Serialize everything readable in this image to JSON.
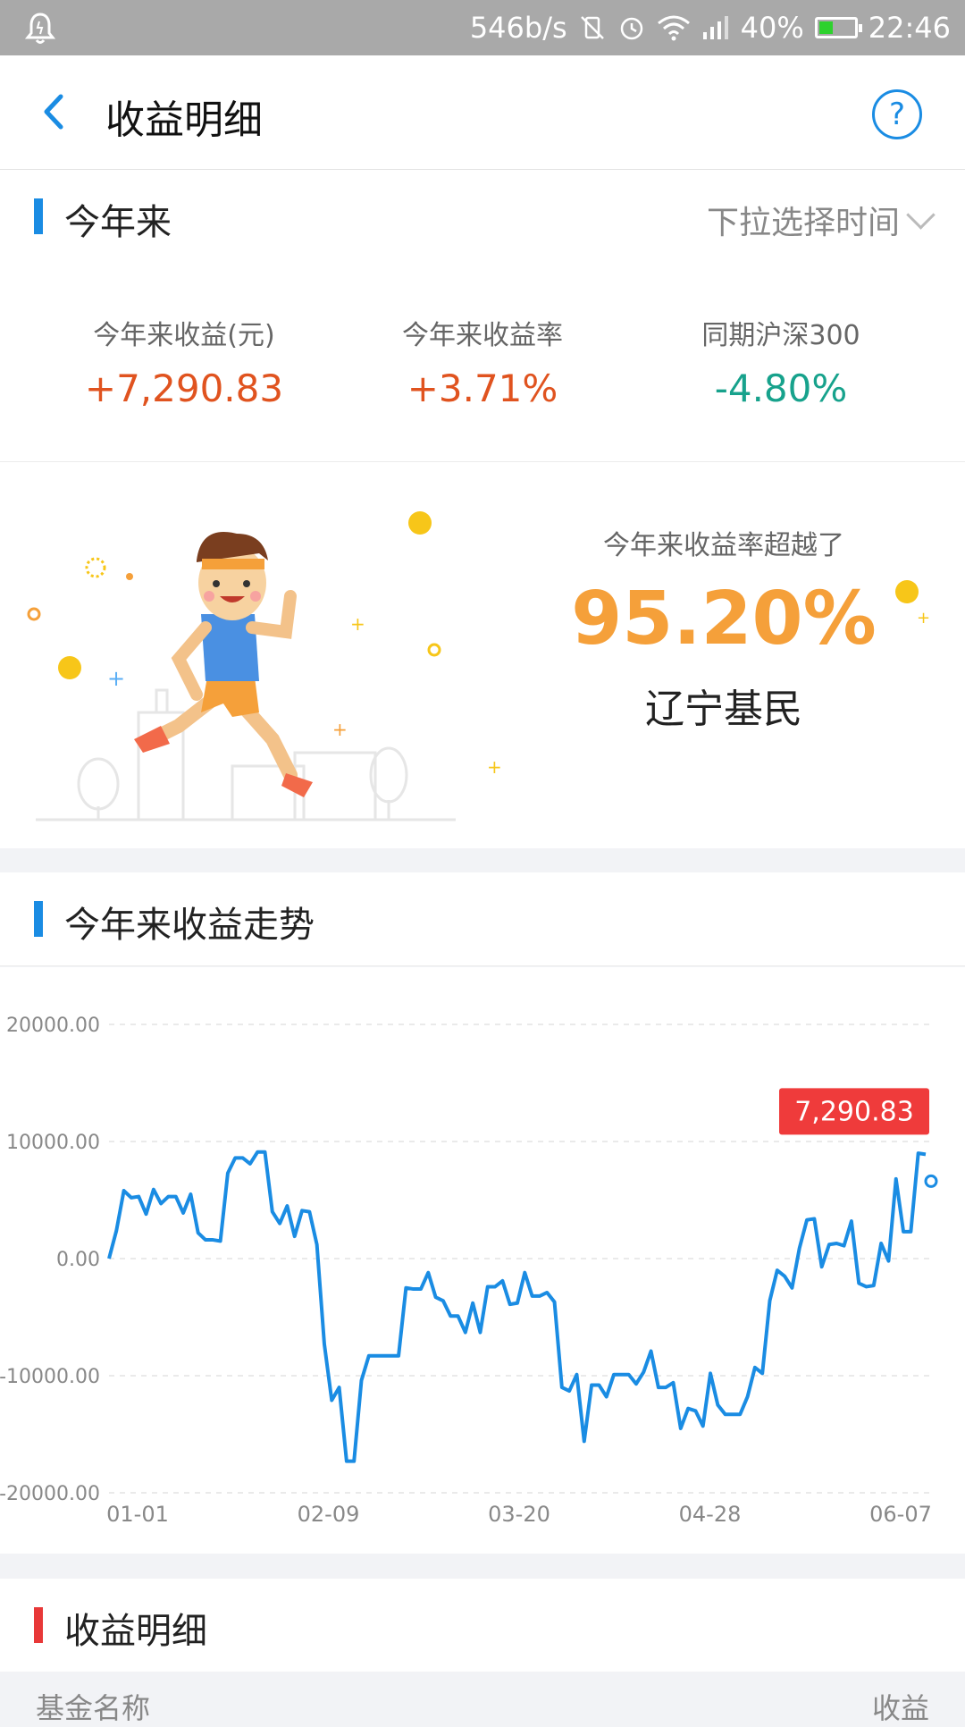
{
  "status_bar": {
    "net_speed": "546b/s",
    "battery": "40%",
    "battery_fraction": 0.4,
    "time": "22:46"
  },
  "header": {
    "title": "收益明细",
    "help_icon": "?"
  },
  "period_section": {
    "title": "今年来",
    "selector_placeholder": "下拉选择时间"
  },
  "stats": [
    {
      "label": "今年来收益(元)",
      "value": "+7,290.83",
      "color": "#e0531f"
    },
    {
      "label": "今年来收益率",
      "value": "+3.71%",
      "color": "#e0531f"
    },
    {
      "label": "同期沪深300",
      "value": "-4.80%",
      "color": "#17a28c"
    }
  ],
  "promo": {
    "label": "今年来收益率超越了",
    "percent": "95.20%",
    "group": "辽宁基民"
  },
  "trend_section": {
    "title": "今年来收益走势"
  },
  "chart_data": {
    "type": "line",
    "y_ticks": [
      "20000.00",
      "10000.00",
      "0.00",
      "-10000.00",
      "-20000.00"
    ],
    "ylim": [
      -20000,
      20000
    ],
    "x_ticks": [
      "01-01",
      "02-09",
      "03-20",
      "04-28",
      "06-07"
    ],
    "latest_label": "7,290.83",
    "line_color": "#1a8ce3",
    "series": [
      {
        "values": [
          0,
          2400,
          5800,
          5200,
          5300,
          3800,
          5900,
          4700,
          5300,
          5300,
          3900,
          5500,
          2200,
          1600,
          1600,
          1500,
          7300,
          8600,
          8600,
          8100,
          9100,
          9100,
          4000,
          3000,
          4500,
          1900,
          4100,
          4000,
          1200,
          -7300,
          -12100,
          -11000,
          -17300,
          -17300,
          -10400,
          -8300,
          -8300,
          -8300,
          -8300,
          -8300,
          -2500,
          -2600,
          -2600,
          -1200,
          -3300,
          -3600,
          -4900,
          -4900,
          -6300,
          -3800,
          -6300,
          -2400,
          -2400,
          -1900,
          -3900,
          -3800,
          -1200,
          -3200,
          -3200,
          -2900,
          -3700,
          -11000,
          -11300,
          -9900,
          -15600,
          -10800,
          -10800,
          -11800,
          -9900,
          -9900,
          -9900,
          -10700,
          -9700,
          -7900,
          -11000,
          -11000,
          -10600,
          -14500,
          -12800,
          -13000,
          -14300,
          -9800,
          -12500,
          -13300,
          -13300,
          -13300,
          -11800,
          -9300,
          -9800,
          -3600,
          -1000,
          -1500,
          -2500,
          900,
          3300,
          3400,
          -700,
          1200,
          1300,
          1100,
          3200,
          -2100,
          -2400,
          -2300,
          1300,
          -200,
          6800,
          2300,
          2300,
          9000,
          8900
        ]
      }
    ]
  },
  "detail_section": {
    "title": "收益明细",
    "col_fund": "基金名称",
    "col_income": "收益"
  }
}
